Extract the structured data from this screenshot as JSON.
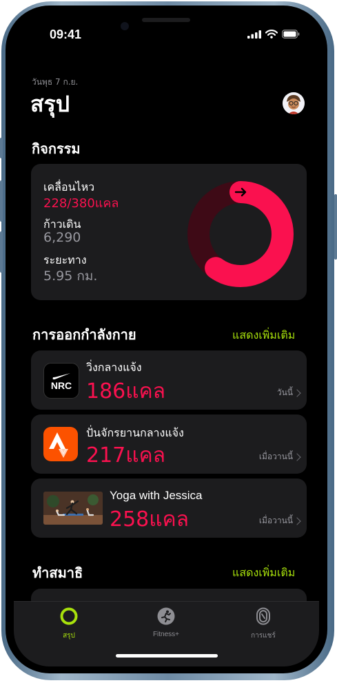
{
  "status": {
    "time": "09:41"
  },
  "header": {
    "date": "วันพุธ 7 ก.ย.",
    "title": "สรุป"
  },
  "activity": {
    "heading": "กิจกรรม",
    "move_label": "เคลื่อนไหว",
    "move_value": "228/380แคล",
    "move_progress": 0.6,
    "steps_label": "ก้าวเดิน",
    "steps_value": "6,290",
    "distance_label": "ระยะทาง",
    "distance_value": "5.95 กม.",
    "ring_color": "#fa114f"
  },
  "workouts": {
    "heading": "การออกกำลังกาย",
    "show_more": "แสดงเพิ่มเติม",
    "items": [
      {
        "title": "วิ่งกลางแจ้ง",
        "calories": "186แคล",
        "when": "วันนี้",
        "icon": "nrc-app-icon",
        "badge": "NRC"
      },
      {
        "title": "ปั่นจักรยานกลางแจ้ง",
        "calories": "217แคล",
        "when": "เมื่อวานนี้",
        "icon": "strava-app-icon"
      },
      {
        "title": "Yoga with Jessica",
        "calories": "258แคล",
        "when": "เมื่อวานนี้",
        "icon": "yoga-thumbnail"
      }
    ]
  },
  "mindfulness": {
    "heading": "ทำสมาธิ",
    "show_more": "แสดงเพิ่มเติม"
  },
  "tabs": [
    {
      "label": "สรุป",
      "icon": "summary-ring-icon",
      "active": true
    },
    {
      "label": "Fitness+",
      "icon": "fitness-plus-icon",
      "active": false
    },
    {
      "label": "การแชร์",
      "icon": "sharing-icon",
      "active": false
    }
  ],
  "colors": {
    "accent": "#a8e10c",
    "move": "#fa114f"
  }
}
